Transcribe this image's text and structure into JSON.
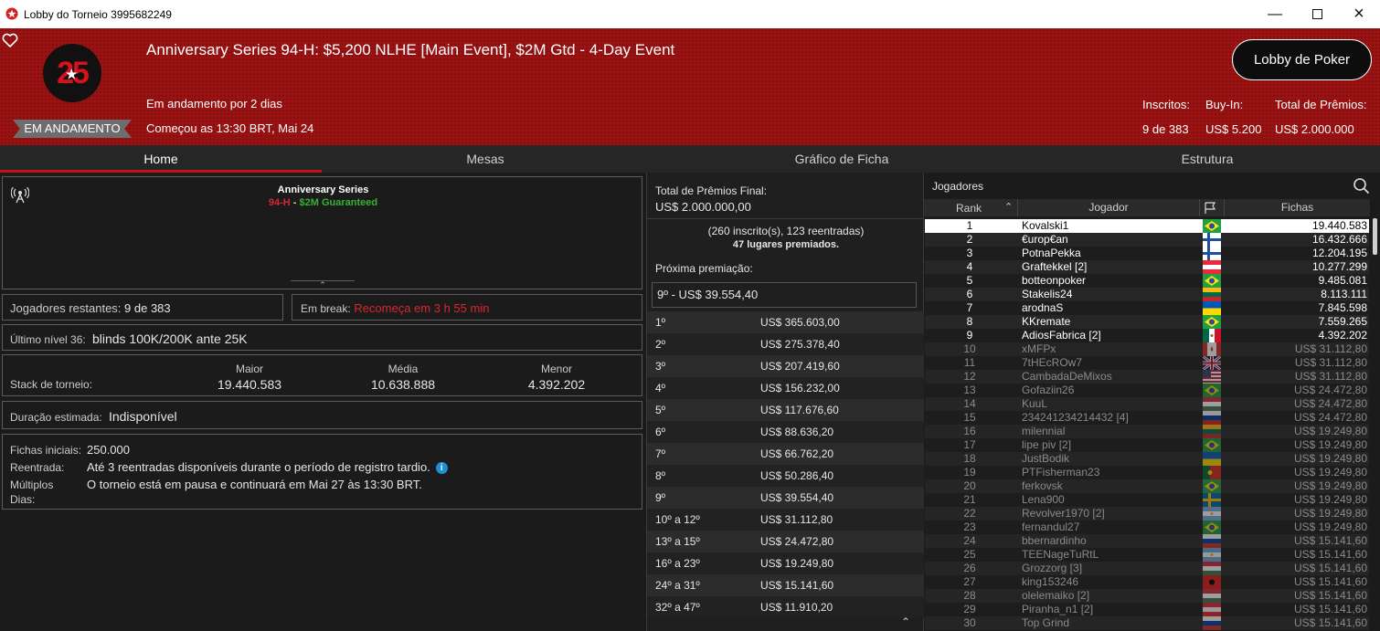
{
  "window": {
    "title": "Lobby do Torneio 3995682249"
  },
  "header": {
    "logo_number": "25",
    "status": "EM ANDAMENTO",
    "title": "Anniversary Series 94-H: $5,200 NLHE [Main Event], $2M Gtd - 4-Day Event",
    "running_for": "Em andamento por 2 dias",
    "started": "Começou as 13:30 BRT, Mai 24",
    "lobby_button": "Lobby de Poker",
    "stats": [
      {
        "label": "Inscritos:",
        "value": "9 de 383"
      },
      {
        "label": "Buy-In:",
        "value": "US$ 5.200"
      },
      {
        "label": "Total de Prêmios:",
        "value": "US$ 2.000.000"
      }
    ]
  },
  "tabs": [
    "Home",
    "Mesas",
    "Gráfico de Ficha",
    "Estrutura"
  ],
  "home": {
    "series_title": "Anniversary Series",
    "series_code": "94-H",
    "series_sep": " - ",
    "series_gtd": "$2M Guaranteed",
    "players_left_label": "Jogadores restantes:",
    "players_left_value": "9 de 383",
    "break_label": "Em break:",
    "break_value": "Recomeça em 3 h 55 min",
    "last_level_label": "Último nível 36:",
    "last_level_value": "blinds 100K/200K ante 25K",
    "stack_label": "Stack de torneio:",
    "stack": [
      {
        "label": "Maior",
        "value": "19.440.583"
      },
      {
        "label": "Média",
        "value": "10.638.888"
      },
      {
        "label": "Menor",
        "value": "4.392.202"
      }
    ],
    "duration_label": "Duração estimada:",
    "duration_value": "Indisponível",
    "chips_label": "Fichas iniciais:",
    "chips_value": "250.000",
    "reentry_label": "Reentrada:",
    "reentry_value": "Até 3 reentradas disponíveis durante o período de registro tardio.",
    "multi_label1": "Múltiplos",
    "multi_label2": "Dias:",
    "multi_value": "O torneio está em pausa e continuará em Mai 27 às 13:30 BRT."
  },
  "prizes": {
    "total_label": "Total de Prêmios Final:",
    "total_value": "US$ 2.000.000,00",
    "entries": "(260 inscrito(s), 123 reentradas)",
    "places": "47 lugares premiados.",
    "next_label": "Próxima premiação:",
    "next_value": "9º - US$ 39.554,40",
    "list": [
      {
        "place": "1º",
        "value": "US$ 365.603,00"
      },
      {
        "place": "2º",
        "value": "US$ 275.378,40"
      },
      {
        "place": "3º",
        "value": "US$ 207.419,60"
      },
      {
        "place": "4º",
        "value": "US$ 156.232,00"
      },
      {
        "place": "5º",
        "value": "US$ 117.676,60"
      },
      {
        "place": "6º",
        "value": "US$ 88.636,20"
      },
      {
        "place": "7º",
        "value": "US$ 66.762,20"
      },
      {
        "place": "8º",
        "value": "US$ 50.286,40"
      },
      {
        "place": "9º",
        "value": "US$ 39.554,40"
      },
      {
        "place": "10º a 12º",
        "value": "US$ 31.112,80"
      },
      {
        "place": "13º a 15º",
        "value": "US$ 24.472,80"
      },
      {
        "place": "16º a 23º",
        "value": "US$ 19.249,80"
      },
      {
        "place": "24º a 31º",
        "value": "US$ 15.141,60"
      },
      {
        "place": "32º a 47º",
        "value": "US$ 11.910,20"
      }
    ]
  },
  "players": {
    "title": "Jogadores",
    "columns": {
      "rank": "Rank",
      "player": "Jogador",
      "chips": "Fichas"
    },
    "rows": [
      {
        "rank": "1",
        "name": "Kovalski1",
        "chips": "19.440.583",
        "flag": "br",
        "active": true
      },
      {
        "rank": "2",
        "name": "€urop€an",
        "chips": "16.432.666",
        "flag": "fi",
        "active": true
      },
      {
        "rank": "3",
        "name": "PotnaPekka",
        "chips": "12.204.195",
        "flag": "fi",
        "active": true
      },
      {
        "rank": "4",
        "name": "Graftekkel [2]",
        "chips": "10.277.299",
        "flag": "at",
        "active": true
      },
      {
        "rank": "5",
        "name": "botteonpoker",
        "chips": "9.485.081",
        "flag": "br",
        "active": true
      },
      {
        "rank": "6",
        "name": "Stakelis24",
        "chips": "8.113.111",
        "flag": "lt",
        "active": true
      },
      {
        "rank": "7",
        "name": "arodnaS",
        "chips": "7.845.598",
        "flag": "ua",
        "active": true
      },
      {
        "rank": "8",
        "name": "KKremate",
        "chips": "7.559.265",
        "flag": "br",
        "active": true
      },
      {
        "rank": "9",
        "name": "AdiosFabrica [2]",
        "chips": "4.392.202",
        "flag": "mx",
        "active": true
      },
      {
        "rank": "10",
        "name": "xMFPx",
        "chips": "US$ 31.112,80",
        "flag": "ca",
        "active": false
      },
      {
        "rank": "11",
        "name": "7tHEcROw7",
        "chips": "US$ 31.112,80",
        "flag": "gb",
        "active": false
      },
      {
        "rank": "12",
        "name": "CambadaDeMixos",
        "chips": "US$ 31.112,80",
        "flag": "us",
        "active": false
      },
      {
        "rank": "13",
        "name": "Gofaziin26",
        "chips": "US$ 24.472,80",
        "flag": "br",
        "active": false
      },
      {
        "rank": "14",
        "name": "KuuL",
        "chips": "US$ 24.472,80",
        "flag": "hu",
        "active": false
      },
      {
        "rank": "15",
        "name": "234241234214432 [4]",
        "chips": "US$ 24.472,80",
        "flag": "ru",
        "active": false
      },
      {
        "rank": "16",
        "name": "milennial",
        "chips": "US$ 19.249,80",
        "flag": "lt",
        "active": false
      },
      {
        "rank": "17",
        "name": "lipe piv [2]",
        "chips": "US$ 19.249,80",
        "flag": "br",
        "active": false
      },
      {
        "rank": "18",
        "name": "JustBodik",
        "chips": "US$ 19.249,80",
        "flag": "ua",
        "active": false
      },
      {
        "rank": "19",
        "name": "PTFisherman23",
        "chips": "US$ 19.249,80",
        "flag": "pt",
        "active": false
      },
      {
        "rank": "20",
        "name": "ferkovsk",
        "chips": "US$ 19.249,80",
        "flag": "br",
        "active": false
      },
      {
        "rank": "21",
        "name": "Lena900",
        "chips": "US$ 19.249,80",
        "flag": "se",
        "active": false
      },
      {
        "rank": "22",
        "name": "Revolver1970 [2]",
        "chips": "US$ 19.249,80",
        "flag": "ar",
        "active": false
      },
      {
        "rank": "23",
        "name": "fernandul27",
        "chips": "US$ 19.249,80",
        "flag": "br",
        "active": false
      },
      {
        "rank": "24",
        "name": "bbernardinho",
        "chips": "US$ 15.141,60",
        "flag": "ru",
        "active": false
      },
      {
        "rank": "25",
        "name": "TEENageTuRtL",
        "chips": "US$ 15.141,60",
        "flag": "ar",
        "active": false
      },
      {
        "rank": "26",
        "name": "Grozzorg [3]",
        "chips": "US$ 15.141,60",
        "flag": "hu",
        "active": false
      },
      {
        "rank": "27",
        "name": "king153246",
        "chips": "US$ 15.141,60",
        "flag": "al",
        "active": false
      },
      {
        "rank": "28",
        "name": "olelemaiko [2]",
        "chips": "US$ 15.141,60",
        "flag": "hu",
        "active": false
      },
      {
        "rank": "29",
        "name": "Piranha_n1 [2]",
        "chips": "US$ 15.141,60",
        "flag": "at",
        "active": false
      },
      {
        "rank": "30",
        "name": "Top Grind",
        "chips": "US$ 15.141,60",
        "flag": "ru",
        "active": false
      }
    ]
  },
  "colors": {
    "header_red": "#9b1212",
    "accent_red": "#c4121a",
    "green": "#34b233",
    "break_red": "#d9262f"
  }
}
